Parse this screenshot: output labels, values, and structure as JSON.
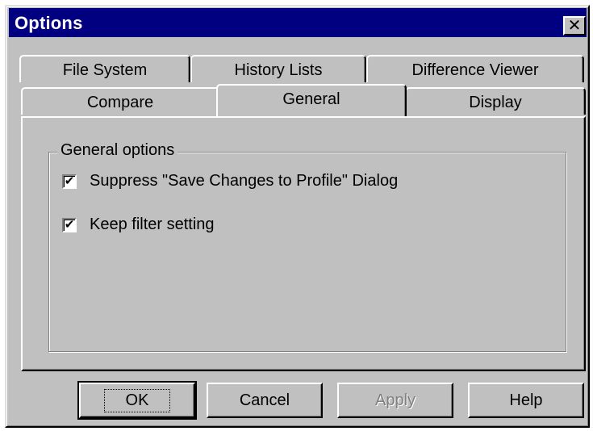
{
  "window": {
    "title": "Options",
    "close_symbol": "✕"
  },
  "tabs": {
    "back_row": [
      "File System",
      "History Lists",
      "Difference Viewer"
    ],
    "front_row": [
      "Compare",
      "General",
      "Display"
    ],
    "active": "General"
  },
  "general": {
    "group_label": "General options",
    "options": [
      {
        "label": "Suppress \"Save Changes to Profile\" Dialog",
        "checked": true
      },
      {
        "label": "Keep filter setting",
        "checked": true
      }
    ]
  },
  "buttons": {
    "ok": "OK",
    "cancel": "Cancel",
    "apply": "Apply",
    "help": "Help"
  },
  "icons": {
    "check_glyph": "✔",
    "close": "close-icon",
    "check": "check-icon"
  },
  "colors": {
    "titlebar": "#000080",
    "face": "#c0c0c0",
    "disabled_text": "#808080"
  }
}
